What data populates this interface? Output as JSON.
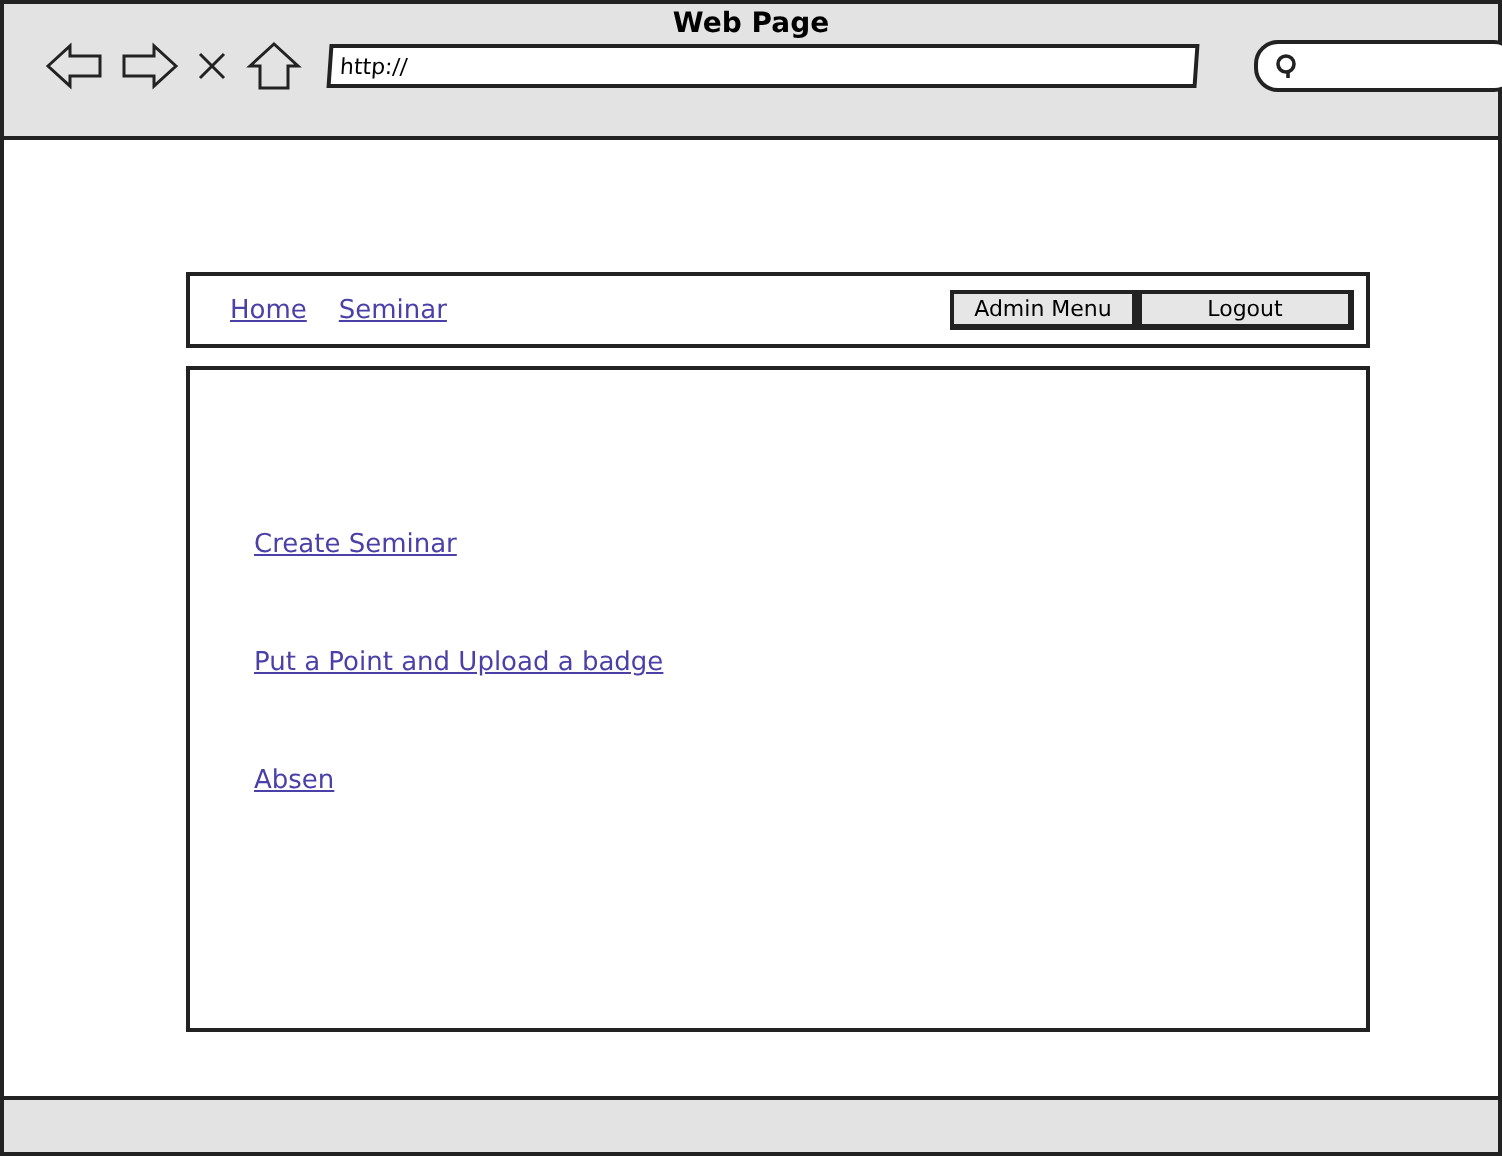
{
  "window": {
    "title": "Web Page"
  },
  "address_bar": {
    "value": "http://"
  },
  "nav": {
    "links": [
      {
        "label": "Home"
      },
      {
        "label": "Seminar"
      }
    ],
    "buttons": [
      {
        "label": "Admin Menu"
      },
      {
        "label": "Logout"
      }
    ]
  },
  "content": {
    "links": [
      {
        "label": "Create Seminar"
      },
      {
        "label": "Put a Point and Upload a badge"
      },
      {
        "label": "Absen"
      }
    ]
  }
}
